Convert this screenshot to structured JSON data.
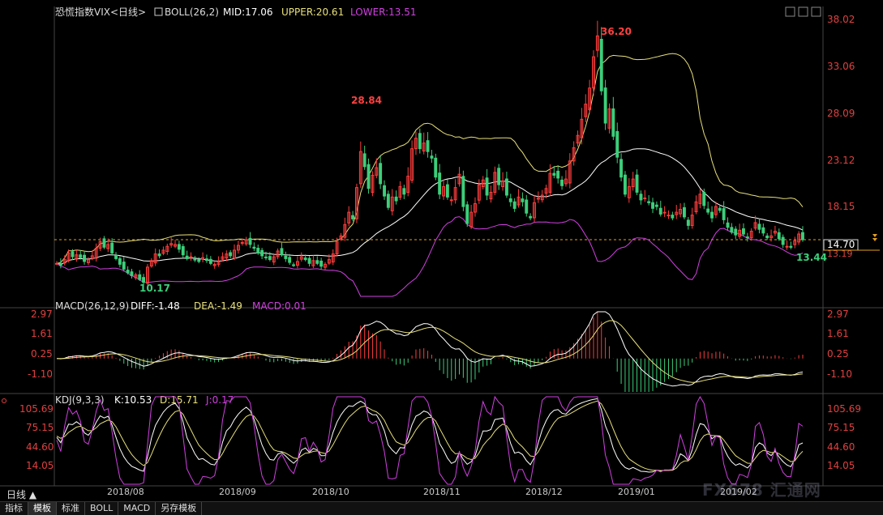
{
  "main_header": {
    "name": "恐慌指数VIX<日线>",
    "indicator": "BOLL(26,2)",
    "mid": "MID:17.06",
    "upper": "UPPER:20.61",
    "lower": "LOWER:13.51"
  },
  "macd_header": {
    "name": "MACD(26,12,9)",
    "diff": "DIFF:-1.48",
    "dea": "DEA:-1.49",
    "macd": "MACD:0.01"
  },
  "kdj_header": {
    "name": "KDJ(9,3,3)",
    "k": "K:10.53",
    "d": "D:15.71",
    "j": "J:0.17"
  },
  "price_axis": [
    "38.02",
    "33.06",
    "28.09",
    "23.12",
    "18.15",
    "14.70",
    "13.19"
  ],
  "macd_axis_left": [
    "2.97",
    "1.61",
    "0.25",
    "-1.10"
  ],
  "macd_axis_right": [
    "2.97",
    "1.61",
    "0.25",
    "-1.10"
  ],
  "kdj_axis_left": [
    "105.69",
    "75.15",
    "44.60",
    "14.05"
  ],
  "kdj_axis_right": [
    "105.69",
    "75.15",
    "44.60",
    "14.05"
  ],
  "annotations": {
    "high1": "28.84",
    "high2": "36.20",
    "low1": "10.17",
    "low2": "13.44"
  },
  "period_label": "日线 ▲",
  "tabs": [
    "指标",
    "模板",
    "标准",
    "BOLL",
    "MACD",
    "另存模板"
  ],
  "watermark": "FX678 汇通网",
  "colors": {
    "up": "#ff3c3c",
    "down": "#3ccf7a",
    "upper": "#e8e07a",
    "mid": "#ffffff",
    "lower": "#d040e0",
    "k": "#ffffff",
    "d": "#e8e07a",
    "j": "#d040e0"
  },
  "chart_data": {
    "type": "candlestick",
    "title": "恐慌指数VIX<日线>",
    "x_ticks": [
      "2018/08",
      "2018/09",
      "2018/10",
      "2018/11",
      "2018/12",
      "2019/01",
      "2019/02"
    ],
    "ylim": [
      10,
      38.02
    ],
    "last_price": 14.7,
    "close": [
      12.2,
      12.0,
      12.6,
      13.3,
      12.9,
      13.1,
      12.8,
      12.4,
      12.6,
      13.0,
      13.8,
      14.5,
      13.9,
      14.2,
      13.3,
      12.7,
      12.1,
      11.6,
      11.2,
      10.9,
      11.0,
      10.5,
      10.2,
      11.8,
      12.5,
      13.2,
      13.0,
      13.6,
      14.0,
      14.3,
      14.2,
      13.7,
      13.1,
      12.7,
      12.9,
      12.6,
      12.4,
      12.8,
      12.5,
      12.2,
      12.1,
      12.4,
      12.9,
      13.2,
      13.0,
      13.6,
      14.1,
      14.4,
      14.7,
      14.2,
      13.8,
      13.3,
      13.0,
      12.8,
      12.6,
      12.9,
      13.5,
      13.1,
      12.7,
      12.3,
      12.0,
      12.4,
      12.9,
      12.6,
      12.2,
      12.5,
      12.2,
      11.9,
      12.1,
      12.6,
      13.2,
      14.5,
      15.1,
      16.3,
      17.6,
      16.9,
      20.2,
      24.0,
      22.4,
      20.1,
      21.5,
      22.3,
      20.6,
      19.3,
      18.1,
      19.2,
      18.8,
      20.3,
      19.5,
      21.4,
      24.3,
      25.4,
      24.3,
      24.9,
      24.0,
      23.3,
      21.3,
      19.5,
      20.3,
      19.2,
      18.9,
      20.2,
      21.6,
      18.2,
      16.4,
      17.6,
      18.5,
      20.5,
      21.0,
      19.4,
      19.7,
      21.8,
      20.5,
      20.9,
      19.4,
      18.7,
      18.0,
      19.2,
      18.7,
      17.5,
      17.0,
      18.6,
      19.1,
      19.4,
      20.1,
      21.7,
      21.5,
      21.2,
      20.4,
      21.1,
      23.0,
      24.4,
      25.7,
      27.4,
      29.0,
      30.7,
      34.0,
      36.2,
      30.4,
      27.0,
      28.5,
      25.6,
      23.4,
      21.3,
      19.5,
      20.3,
      21.1,
      19.7,
      18.9,
      19.1,
      18.6,
      18.0,
      18.2,
      17.4,
      17.6,
      17.3,
      17.0,
      17.6,
      17.9,
      17.1,
      16.2,
      17.3,
      18.7,
      19.5,
      18.3,
      17.6,
      17.0,
      18.2,
      17.8,
      16.8,
      16.0,
      15.5,
      15.2,
      15.7,
      15.3,
      14.9,
      15.6,
      16.5,
      15.8,
      15.4,
      14.9,
      15.1,
      15.6,
      14.8,
      14.2,
      14.0,
      13.9,
      14.6,
      15.3,
      14.7
    ]
  }
}
